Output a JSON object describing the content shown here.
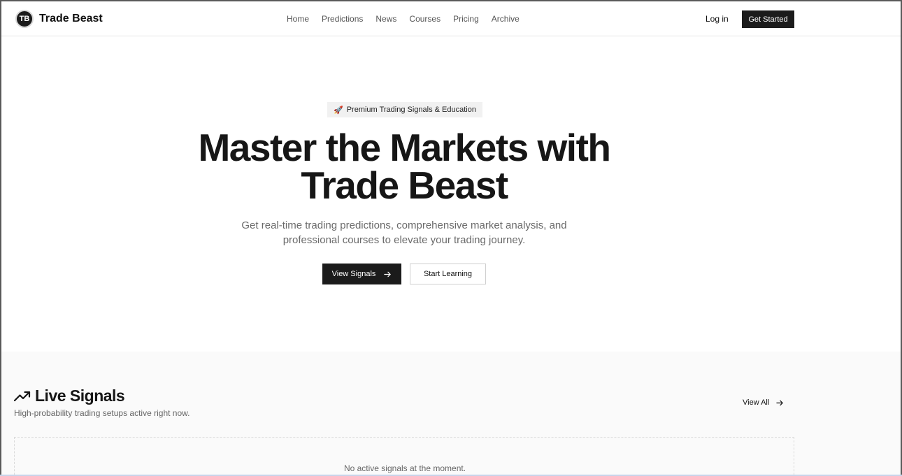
{
  "nav": {
    "logo_text": "TB",
    "brand": "Trade Beast",
    "links": [
      "Home",
      "Predictions",
      "News",
      "Courses",
      "Pricing",
      "Archive"
    ],
    "login": "Log in",
    "cta": "Get Started"
  },
  "hero": {
    "badge_emoji": "🚀",
    "badge_text": "Premium Trading Signals & Education",
    "title_line1": "Master the Markets with",
    "title_line2": "Trade Beast",
    "subtitle_line1": "Get real-time trading predictions, comprehensive market analysis, and",
    "subtitle_line2": "professional courses to elevate your trading journey.",
    "primary_button": "View Signals",
    "secondary_button": "Start Learning"
  },
  "signals": {
    "title": "Live Signals",
    "description": "High-probability trading setups active right now.",
    "view_all": "View All",
    "empty_message": "No active signals at the moment.",
    "icon": "trending-up-icon"
  },
  "colors": {
    "primary": "#1b1b1b",
    "muted_text": "#6a6a6a",
    "section_bg": "#fafafa"
  }
}
